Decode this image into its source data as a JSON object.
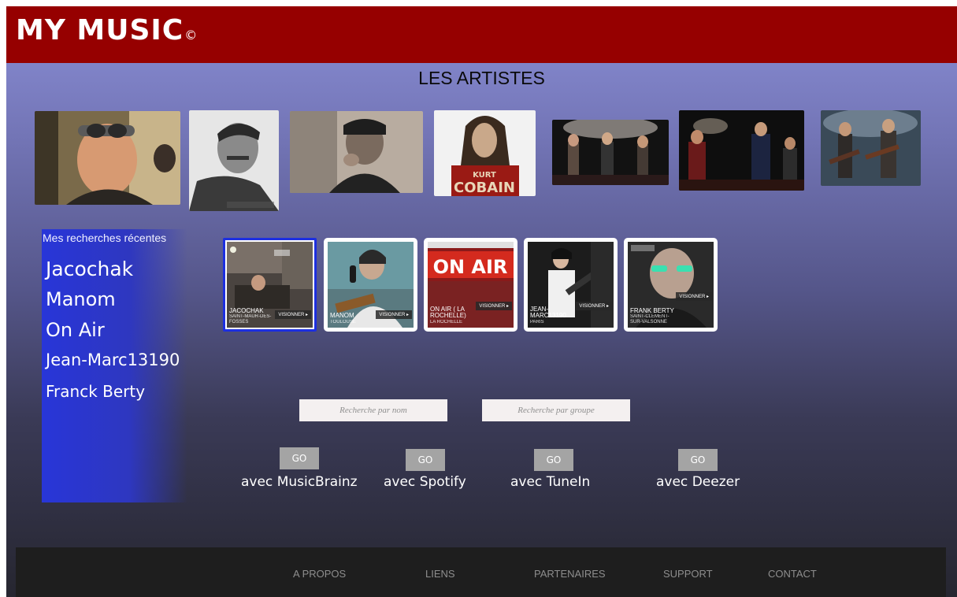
{
  "header": {
    "brand": "MY MUSIC",
    "brand_mark": "©"
  },
  "section_title": "LES ARTISTES",
  "recent": {
    "title": "Mes recherches récentes",
    "items": [
      "Jacochak",
      "Manom",
      "On Air",
      "Jean-Marc13190",
      "Franck Berty"
    ]
  },
  "cards": [
    {
      "name": "JACOCHAK",
      "city": "SAINT-MAUR-DES-FOSSES",
      "visit": "VISIONNER ▸"
    },
    {
      "name": "MANOM",
      "city": "TOULOUSE",
      "visit": "VISIONNER ▸"
    },
    {
      "name": "ON AIR ( LA ROCHELLE)",
      "city": "LA ROCHELLE",
      "visit": "VISIONNER ▸",
      "banner": "ON AIR"
    },
    {
      "name": "JEAN-MARC13190",
      "city": "PARIS",
      "visit": "VISIONNER ▸"
    },
    {
      "name": "FRANK BERTY",
      "city": "SAINT-CLEMENT-SUR-VALSONNE",
      "visit": "VISIONNER ▸"
    }
  ],
  "photo_text": {
    "cobain": "KURT COBAIN"
  },
  "search": {
    "by_name_placeholder": "Recherche par nom",
    "by_group_placeholder": "Recherche par groupe"
  },
  "services": [
    {
      "go": "GO",
      "label": "avec MusicBrainz"
    },
    {
      "go": "GO",
      "label": "avec Spotify"
    },
    {
      "go": "GO",
      "label": "avec TuneIn"
    },
    {
      "go": "GO",
      "label": "avec Deezer"
    }
  ],
  "footer": {
    "links": [
      "A PROPOS",
      "LIENS",
      "PARTENAIRES",
      "SUPPORT",
      "CONTACT"
    ]
  },
  "colors": {
    "header": "#960000",
    "recent_panel": "#2836d8",
    "selected_card_border": "#1d2fe0",
    "footer": "#1e1e1e"
  }
}
